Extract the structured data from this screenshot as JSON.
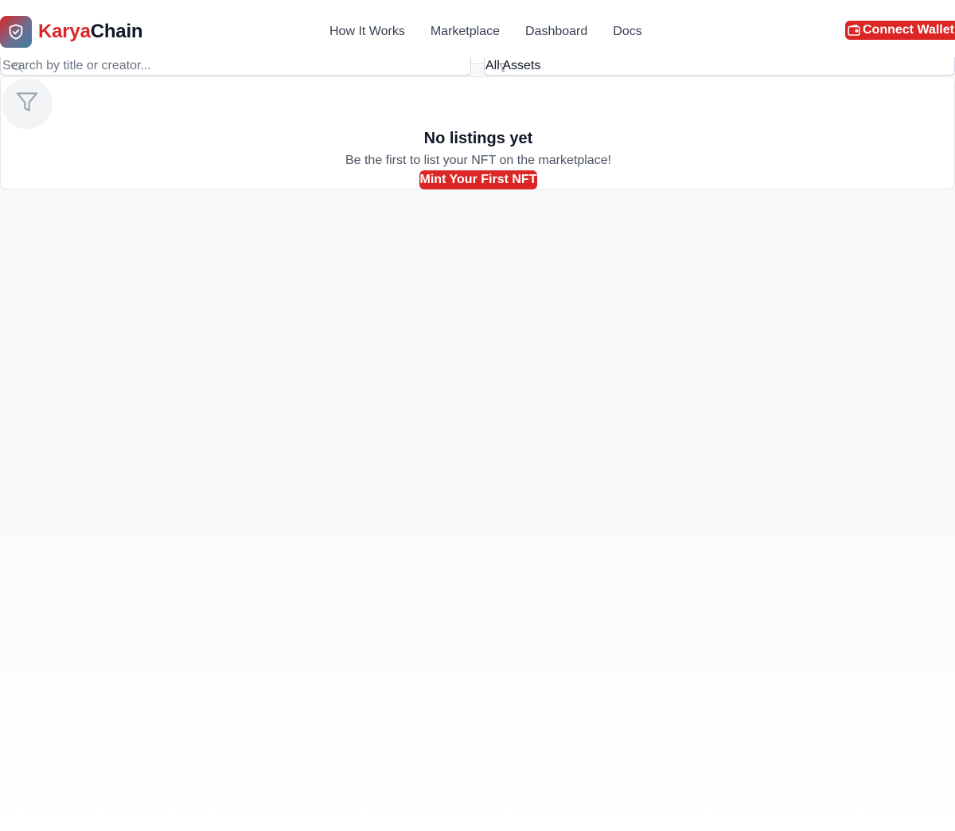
{
  "header": {
    "brand_first": "Karya",
    "brand_second": "Chain",
    "connect_label": "Connect Wallet"
  },
  "nav": {
    "items": [
      {
        "label": "How It Works"
      },
      {
        "label": "Marketplace"
      },
      {
        "label": "Dashboard"
      },
      {
        "label": "Docs"
      }
    ]
  },
  "filters": {
    "search_placeholder": "Search by title or creator...",
    "asset_filter_value": "All Assets"
  },
  "empty_state": {
    "title": "No listings yet",
    "subtitle": "Be the first to list your NFT on the marketplace!",
    "cta_label": "Mint Your First NFT"
  },
  "colors": {
    "accent": "#dc2626",
    "text_primary": "#111827",
    "text_secondary": "#4b5563",
    "border": "#e5e7eb"
  },
  "icons": {
    "logo": "shield-check-icon",
    "wallet": "wallet-icon",
    "search": "search-icon",
    "select": "filter-icon",
    "empty": "filter-icon"
  }
}
